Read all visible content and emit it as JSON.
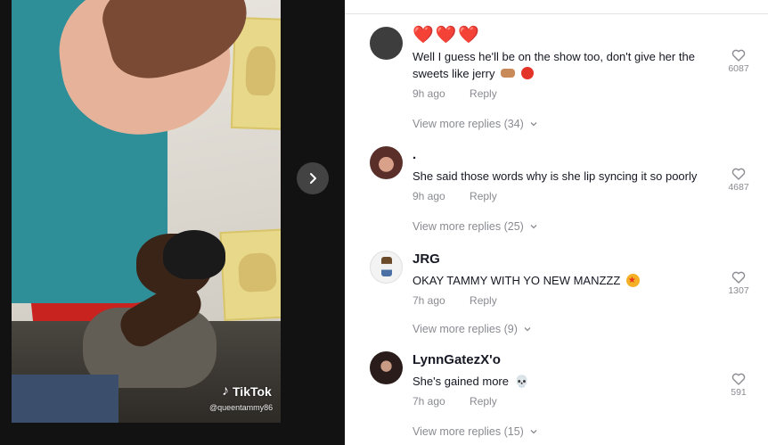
{
  "video": {
    "watermark": "TikTok",
    "handle": "@queentammy86",
    "next_icon": "chevron-right-icon"
  },
  "comments": [
    {
      "username": "❤️❤️❤️",
      "text": "Well I guess he'll be on the show too, don't give her the sweets like jerry",
      "time": "9h ago",
      "reply_label": "Reply",
      "likes": "6087",
      "view_more": "View more replies (34)"
    },
    {
      "username": ".",
      "text": "She said those words why is she lip syncing it so poorly",
      "time": "9h ago",
      "reply_label": "Reply",
      "likes": "4687",
      "view_more": "View more replies (25)"
    },
    {
      "username": "JRG",
      "text": "OKAY TAMMY WITH YO NEW MANZZZ",
      "time": "7h ago",
      "reply_label": "Reply",
      "likes": "1307",
      "view_more": "View more replies (9)"
    },
    {
      "username": "LynnGatezX'o",
      "text": "She's gained more",
      "time": "7h ago",
      "reply_label": "Reply",
      "likes": "591",
      "view_more": "View more replies (15)"
    }
  ],
  "colors": {
    "text_primary": "#161823",
    "text_secondary": "#8a8b91",
    "heart_red": "#e0242f"
  }
}
